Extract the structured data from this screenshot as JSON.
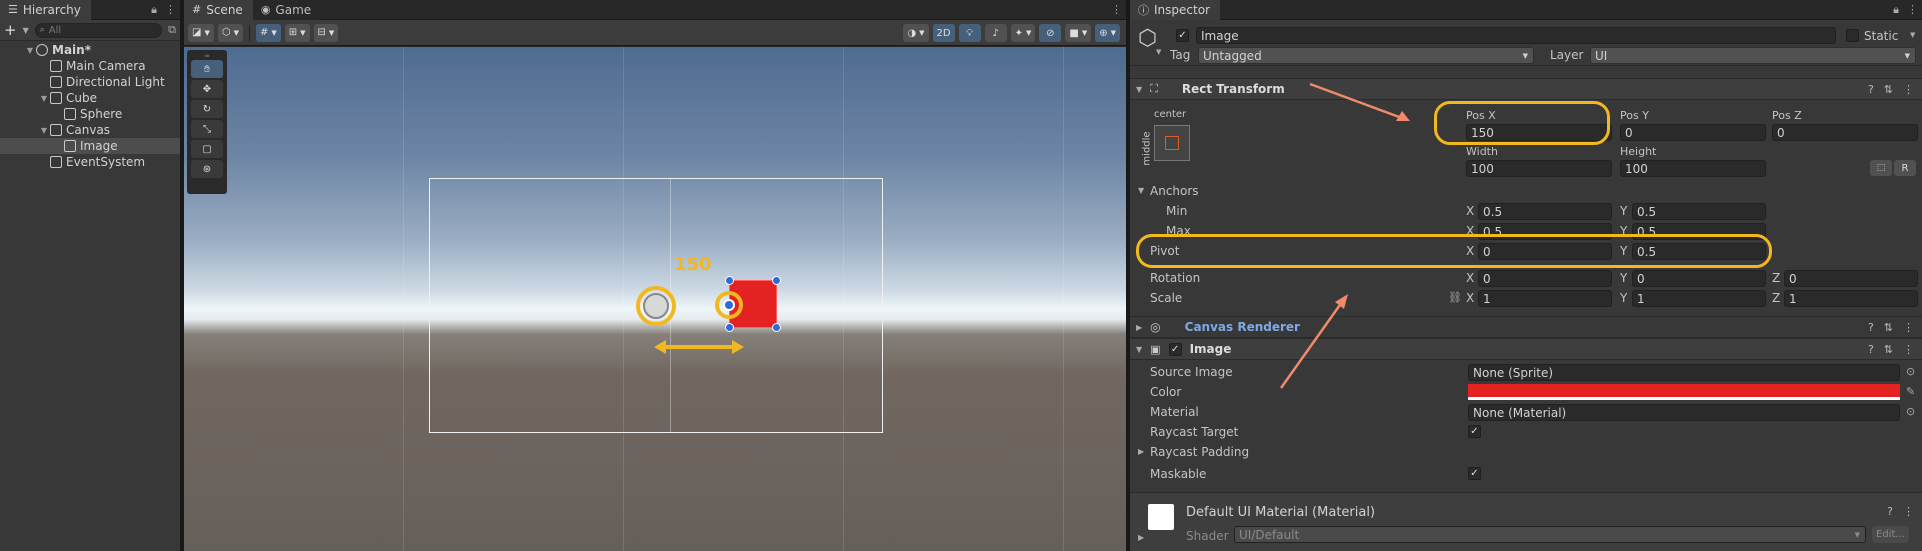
{
  "hierarchy": {
    "tab": "Hierarchy",
    "search_placeholder": "All",
    "items": [
      {
        "label": "Main*",
        "depth": 0,
        "expanded": true
      },
      {
        "label": "Main Camera",
        "depth": 1
      },
      {
        "label": "Directional Light",
        "depth": 1
      },
      {
        "label": "Cube",
        "depth": 1,
        "expanded": true
      },
      {
        "label": "Sphere",
        "depth": 2
      },
      {
        "label": "Canvas",
        "depth": 1,
        "expanded": true
      },
      {
        "label": "Image",
        "depth": 2,
        "selected": true
      },
      {
        "label": "EventSystem",
        "depth": 1
      }
    ]
  },
  "scene": {
    "tabs": [
      "Scene",
      "Game"
    ],
    "mode_2d": "2D",
    "measure_label": "150",
    "accent": "#f2b820",
    "image_color": "#e52222"
  },
  "inspector": {
    "tab": "Inspector",
    "object_name": "Image",
    "static_label": "Static",
    "tag_label": "Tag",
    "tag_value": "Untagged",
    "layer_label": "Layer",
    "layer_value": "UI",
    "rect_transform": {
      "title": "Rect Transform",
      "anchor_preset_h": "center",
      "anchor_preset_v": "middle",
      "pos_x_label": "Pos X",
      "pos_x": "150",
      "pos_y_label": "Pos Y",
      "pos_y": "0",
      "pos_z_label": "Pos Z",
      "pos_z": "0",
      "width_label": "Width",
      "width": "100",
      "height_label": "Height",
      "height": "100",
      "r_button": "R",
      "anchors_label": "Anchors",
      "min_label": "Min",
      "min_x": "0.5",
      "min_y": "0.5",
      "max_label": "Max",
      "max_x": "0.5",
      "max_y": "0.5",
      "pivot_label": "Pivot",
      "pivot_x": "0",
      "pivot_y": "0.5",
      "rotation_label": "Rotation",
      "rot_x": "0",
      "rot_y": "0",
      "rot_z": "0",
      "scale_label": "Scale",
      "scale_x": "1",
      "scale_y": "1",
      "scale_z": "1",
      "x": "X",
      "y": "Y",
      "z": "Z"
    },
    "canvas_renderer": {
      "title": "Canvas Renderer"
    },
    "image": {
      "title": "Image",
      "source_image_label": "Source Image",
      "source_image": "None (Sprite)",
      "color_label": "Color",
      "color": "#e52222",
      "material_label": "Material",
      "material": "None (Material)",
      "raycast_target_label": "Raycast Target",
      "raycast_padding_label": "Raycast Padding",
      "maskable_label": "Maskable"
    },
    "material": {
      "name": "Default UI Material (Material)",
      "shader_label": "Shader",
      "shader": "UI/Default",
      "edit_button": "Edit..."
    }
  }
}
